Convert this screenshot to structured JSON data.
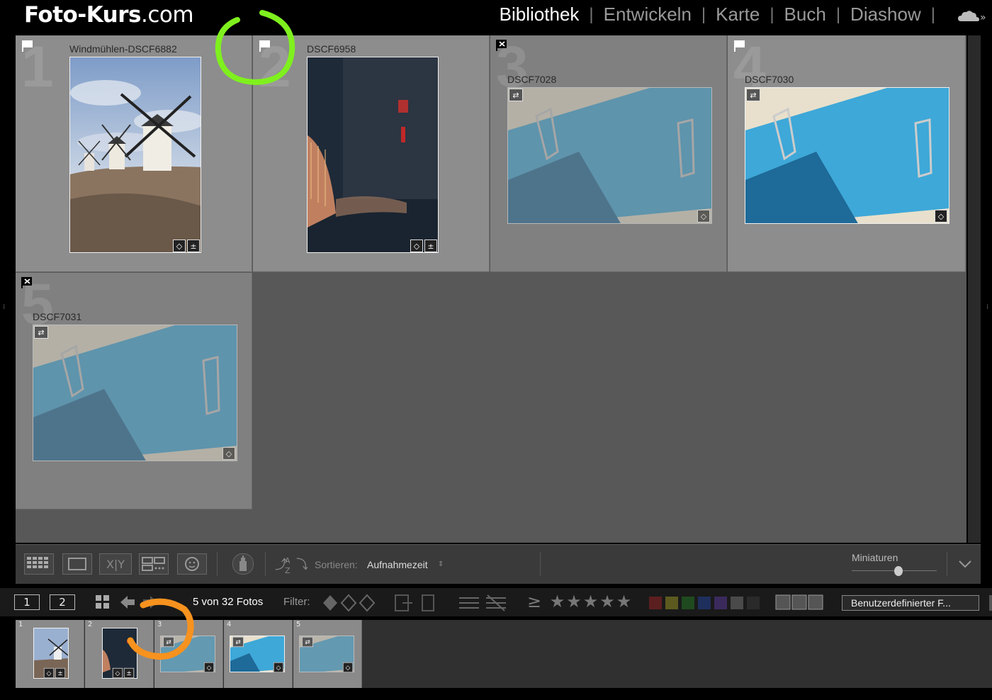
{
  "app": {
    "logo_bold": "Foto-Kurs",
    "logo_rest": ".com"
  },
  "modules": [
    {
      "label": "Bibliothek",
      "active": true
    },
    {
      "label": "Entwickeln",
      "active": false
    },
    {
      "label": "Karte",
      "active": false
    },
    {
      "label": "Buch",
      "active": false
    },
    {
      "label": "Diashow",
      "active": false
    }
  ],
  "grid": {
    "photos": [
      {
        "number": "1",
        "filename": "Windmühlen-DSCF6882",
        "flag": "flagged",
        "scene": "windmills",
        "badges": [
          "keyword-icon",
          "edit-icon"
        ]
      },
      {
        "number": "2",
        "filename": "DSCF6958",
        "flag": "flagged",
        "scene": "church",
        "badges": [
          "keyword-icon",
          "edit-icon"
        ]
      },
      {
        "number": "3",
        "filename": "DSCF7028",
        "flag": "rejected",
        "scene": "pool",
        "badges": [
          "keyword-icon"
        ]
      },
      {
        "number": "4",
        "filename": "DSCF7030",
        "flag": "flagged",
        "scene": "pool",
        "badges": [
          "keyword-icon"
        ]
      },
      {
        "number": "5",
        "filename": "DSCF7031",
        "flag": "rejected",
        "scene": "pool",
        "badges": [
          "keyword-icon"
        ]
      }
    ]
  },
  "toolbar": {
    "sort_label": "Sortieren:",
    "sort_value": "Aufnahmezeit",
    "thumbnail_label": "Miniaturen",
    "thumbnail_size": 0.55
  },
  "filmbar": {
    "page1": "1",
    "page2": "2",
    "count_text": "5 von 32 Fotos",
    "filter_label": "Filter:",
    "stars": "≥ ★★★★★",
    "color_labels": [
      "#5c1f1f",
      "#5c5a1f",
      "#1f4a1f",
      "#1f2f5c",
      "#3a2a5c",
      "#4a4a4a",
      "#2a2a2a"
    ],
    "preset": "Benutzerdefinierter F..."
  },
  "filmstrip": [
    {
      "number": "1",
      "scene": "windmills"
    },
    {
      "number": "2",
      "scene": "church"
    },
    {
      "number": "3",
      "scene": "pool"
    },
    {
      "number": "4",
      "scene": "pool"
    },
    {
      "number": "5",
      "scene": "pool"
    }
  ],
  "annotations": {
    "green_circle_color": "#7ff01e",
    "orange_circle_color": "#f7921e"
  }
}
